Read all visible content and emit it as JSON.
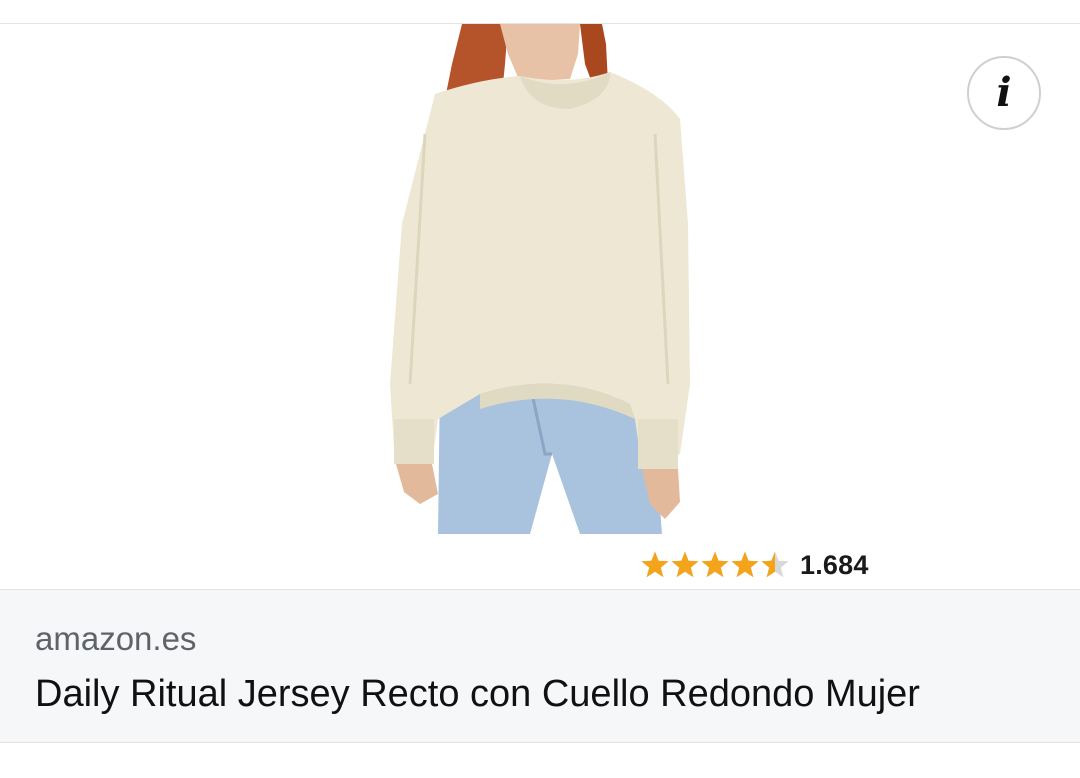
{
  "result": {
    "image_alt": "Daily Ritual Jersey Recto con Cuello Redondo Mujer",
    "info_icon": "info-icon",
    "rating": {
      "stars": 4.5,
      "max_stars": 5,
      "count": "1.684",
      "star_color": "#f4a41b",
      "star_empty_color": "#d8d8d8"
    },
    "source": "amazon.es",
    "title": "Daily Ritual Jersey Recto con Cuello Redondo Mujer"
  },
  "colors": {
    "panel_background": "#f6f7f9",
    "source_text": "#5f6368",
    "title_text": "#111111"
  }
}
